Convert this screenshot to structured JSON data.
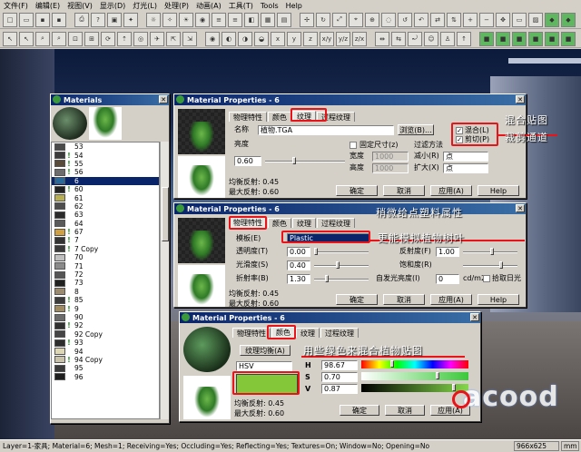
{
  "menu": [
    "文件(F)",
    "编辑(E)",
    "视图(V)",
    "显示(D)",
    "灯光(L)",
    "处理(P)",
    "动画(A)",
    "工具(T)",
    "Tools",
    "Help"
  ],
  "toolbar1": [
    "x",
    "y",
    "z",
    "x/y",
    "y/z",
    "z/x"
  ],
  "status": {
    "text": "Layer=1-家具; Material=6; Mesh=1; Receiving=Yes; Occluding=Yes; Reflecting=Yes; Textures=On; Window=No; Opening=No",
    "size": "966x625",
    "unit": "mm"
  },
  "materials": {
    "title": "Materials",
    "rows": [
      {
        "id": "53",
        "bang": false,
        "color": "#4a4a4a"
      },
      {
        "id": "54",
        "bang": true,
        "color": "#3b3b3b"
      },
      {
        "id": "55",
        "bang": true,
        "color": "#5a4a38"
      },
      {
        "id": "56",
        "bang": true,
        "color": "#6d6d6d"
      },
      {
        "id": "6",
        "bang": false,
        "color": "#2a6a9a",
        "sel": true
      },
      {
        "id": "60",
        "bang": true,
        "color": "#222222"
      },
      {
        "id": "61",
        "bang": false,
        "color": "#b8b050"
      },
      {
        "id": "62",
        "bang": false,
        "color": "#4e4e4e"
      },
      {
        "id": "63",
        "bang": false,
        "color": "#2b2b2b"
      },
      {
        "id": "64",
        "bang": false,
        "color": "#5a5a5a"
      },
      {
        "id": "67",
        "bang": true,
        "color": "#d0a040"
      },
      {
        "id": "7",
        "bang": true,
        "color": "#333333"
      },
      {
        "id": "7 Copy",
        "bang": true,
        "color": "#3a3a3a"
      },
      {
        "id": "70",
        "bang": false,
        "color": "#bfbfbf"
      },
      {
        "id": "71",
        "bang": false,
        "color": "#8a8a8a"
      },
      {
        "id": "72",
        "bang": false,
        "color": "#555555"
      },
      {
        "id": "73",
        "bang": false,
        "color": "#202020"
      },
      {
        "id": "8",
        "bang": false,
        "color": "#9a8a70"
      },
      {
        "id": "85",
        "bang": true,
        "color": "#3c3c3c"
      },
      {
        "id": "9",
        "bang": true,
        "color": "#a08a60"
      },
      {
        "id": "90",
        "bang": false,
        "color": "#6b6b6b"
      },
      {
        "id": "92",
        "bang": true,
        "color": "#303030"
      },
      {
        "id": "92 Copy",
        "bang": false,
        "color": "#454545"
      },
      {
        "id": "93",
        "bang": true,
        "color": "#2d2d2d"
      },
      {
        "id": "94",
        "bang": false,
        "color": "#ddd7b5"
      },
      {
        "id": "94 Copy",
        "bang": true,
        "color": "#c8c2a8"
      },
      {
        "id": "95",
        "bang": false,
        "color": "#3a3a3a"
      },
      {
        "id": "96",
        "bang": false,
        "color": "#1e1e1e"
      }
    ]
  },
  "win1": {
    "title": "Material Properties - 6",
    "tabs": [
      "物理特性",
      "颜色",
      "纹理",
      "过程纹理"
    ],
    "name_label": "名称",
    "name_value": "植物.TGA",
    "browse": "浏览(B)...",
    "brightness_label": "亮度",
    "brightness_value": "0.60",
    "fixed_size": "固定尺寸(z)",
    "width_label": "宽度",
    "width_value": "1000",
    "height_label": "高度",
    "height_value": "1000",
    "filter_label": "过滤方法",
    "reduce_label": "减小(R)",
    "reduce_value": "点",
    "expand_label": "扩大(X)",
    "expand_value": "点",
    "mix_label": "混合(L)",
    "clip_label": "剪切(P)",
    "avg_reflect_label": "均衡反射",
    "avg_reflect_value": ": 0.45",
    "max_reflect_label": "最大反射",
    "max_reflect_value": ": 0.60",
    "ok": "确定",
    "cancel": "取消",
    "apply": "应用(A)",
    "help": "Help"
  },
  "win2": {
    "title": "Material Properties - 6",
    "tabs": [
      "物理特性",
      "颜色",
      "纹理",
      "过程纹理"
    ],
    "template_label": "模板(E)",
    "template_value": "Plastic",
    "transparency_label": "透明度(T)",
    "transparency_value": "0.00",
    "gloss_label": "光滑度(S)",
    "gloss_value": "0.40",
    "refract_label": "折射率(B)",
    "refract_value": "1.30",
    "reflect_label": "反射度(F)",
    "reflect_value": "1.00",
    "sat_label": "饱和度(R)",
    "self_label": "自发光亮度(I)",
    "self_value": "0",
    "self_unit": "cd/m2",
    "pick_label": "拾取日光",
    "avg_reflect_label": "均衡反射",
    "avg_reflect_value": ": 0.45",
    "max_reflect_label": "最大反射",
    "max_reflect_value": ": 0.60",
    "ok": "确定",
    "cancel": "取消",
    "apply": "应用(A)",
    "help": "Help"
  },
  "win3": {
    "title": "Material Properties - 6",
    "tabs": [
      "物理特性",
      "颜色",
      "纹理",
      "过程纹理"
    ],
    "tex_avg": "纹理均衡(A)",
    "model": "HSV",
    "h_label": "H",
    "h_value": "98.67",
    "s_label": "S",
    "s_value": "0.70",
    "v_label": "V",
    "v_value": "0.87",
    "avg_reflect_label": "均衡反射",
    "avg_reflect_value": ": 0.45",
    "max_reflect_label": "最大反射",
    "max_reflect_value": ": 0.60",
    "ok": "确定",
    "cancel": "取消",
    "apply": "应用(A)",
    "swatch_color": "#84c83a"
  },
  "notes": {
    "n1": "混合贴图",
    "n2": "裁剪通道",
    "n3": "稍微给点塑料属性",
    "n4": "更能模拟植物树叶",
    "n5": "用些绿色来混合植物贴图"
  },
  "watermark": "acood"
}
